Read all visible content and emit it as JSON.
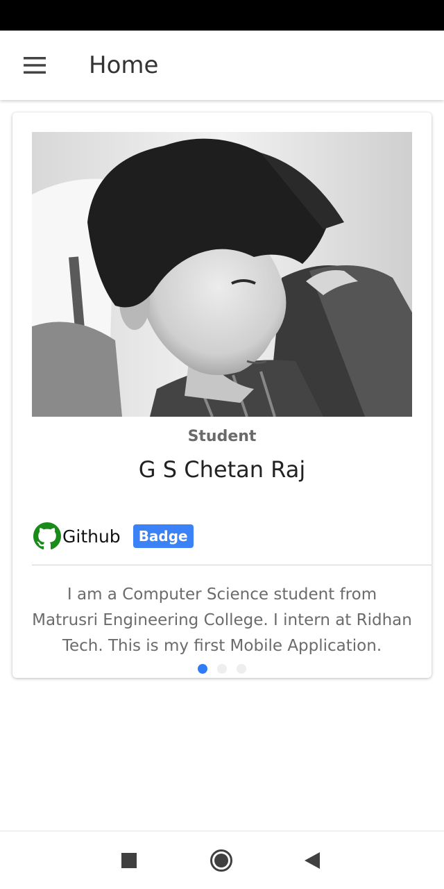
{
  "app_bar": {
    "title": "Home",
    "menu_icon": "hamburger-menu-icon"
  },
  "profile_card": {
    "photo_alt": "profile photo",
    "role": "Student",
    "name": "G S Chetan Raj",
    "github": {
      "icon": "github-icon",
      "label": "Github",
      "icon_color": "#1a8a1a"
    },
    "badge": {
      "label": "Badge",
      "color": "#3b82f6"
    },
    "bio": "I am a Computer Science student from Matrusri Engineering College. I intern at Ridhan Tech. This is my first Mobile Application.",
    "pagination": {
      "total": 3,
      "active_index": 0,
      "active_color": "#2f7cf6"
    }
  },
  "system_nav": {
    "recents_icon": "square-recents-icon",
    "home_icon": "circle-home-icon",
    "back_icon": "triangle-back-icon"
  }
}
